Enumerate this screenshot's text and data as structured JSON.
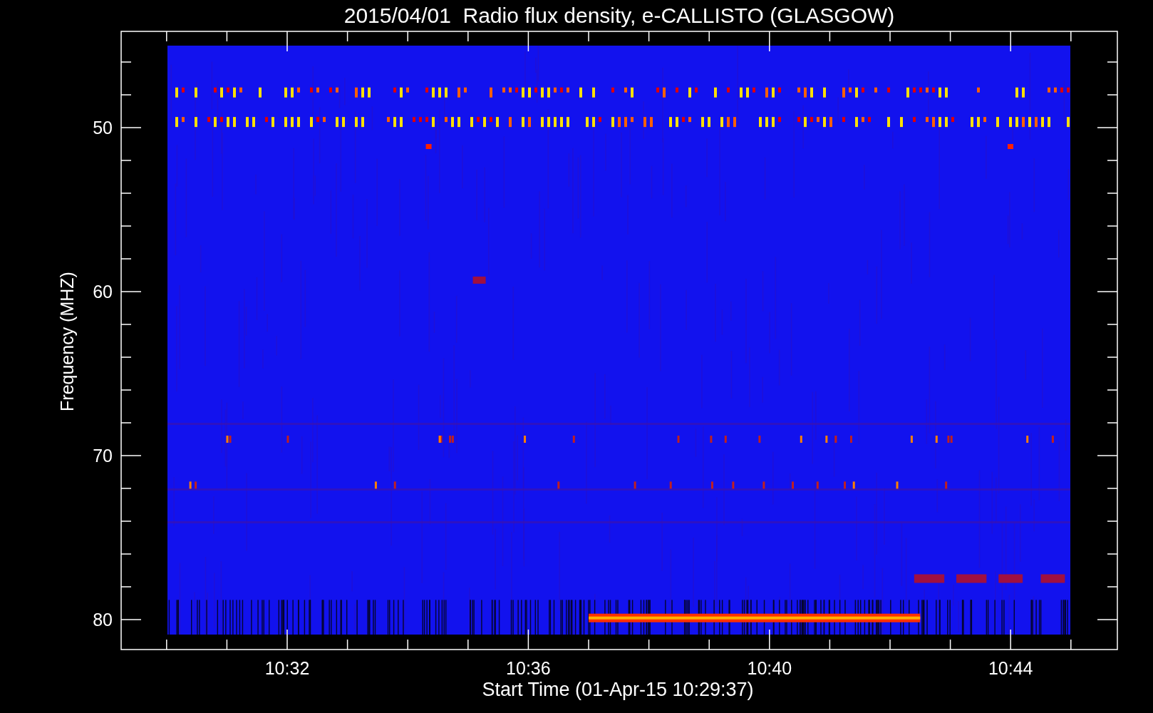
{
  "plot": {
    "title": "2015/04/01  Radio flux density, e-CALLISTO (GLASGOW)",
    "xlabel": "Start Time (01-Apr-15 10:29:37)",
    "ylabel": "Frequency (MHZ)",
    "xtick_labels": [
      "10:32",
      "10:36",
      "10:40",
      "10:44"
    ],
    "ytick_labels": [
      "50",
      "60",
      "70",
      "80"
    ]
  }
}
